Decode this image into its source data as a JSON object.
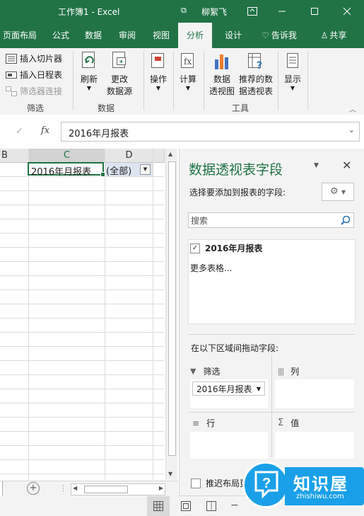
{
  "window": {
    "title": "工作簿1 - Excel",
    "user": "柳絮飞"
  },
  "tabs": [
    {
      "label": "页面布局"
    },
    {
      "label": "公式"
    },
    {
      "label": "数据"
    },
    {
      "label": "审阅"
    },
    {
      "label": "视图"
    },
    {
      "label": "分析"
    },
    {
      "label": "设计"
    },
    {
      "label": "告诉我"
    },
    {
      "label": "共享"
    }
  ],
  "ribbon": {
    "filter_group": {
      "insert_slicer": "插入切片器",
      "insert_timeline": "插入日程表",
      "filter_connections": "筛选器连接",
      "label": "筛选"
    },
    "data_group": {
      "refresh": "刷新",
      "change_source_1": "更改",
      "change_source_2": "数据源",
      "label": "数据"
    },
    "actions": "操作",
    "calculate": "计算",
    "tools_group": {
      "pivotchart_1": "数据",
      "pivotchart_2": "透视图",
      "recommended_1": "推荐的数",
      "recommended_2": "据透视表",
      "label": "工具"
    },
    "show": "显示"
  },
  "formula_bar": {
    "fx": "fx",
    "value": "2016年月报表"
  },
  "sheet": {
    "columns": [
      "B",
      "C",
      "D"
    ],
    "cell_c1": "2016年月报表",
    "cell_d1": "(全部)"
  },
  "pivot_panel": {
    "title": "数据透视表字段",
    "subtitle": "选择要添加到报表的字段:",
    "search_placeholder": "搜索",
    "field": "2016年月报表",
    "more_tables": "更多表格...",
    "drag_label": "在以下区域间拖动字段:",
    "filters_label": "筛选",
    "filter_chip": "2016年月报表",
    "columns_label": "列",
    "rows_label": "行",
    "values_label": "值",
    "defer_label": "推迟布局更"
  },
  "watermark": {
    "brand": "知识屋",
    "url": "zhishiwu.com"
  },
  "colors": {
    "excel_green": "#217346",
    "ribbon_bg": "#f3f3f3",
    "selection": "#217346"
  }
}
